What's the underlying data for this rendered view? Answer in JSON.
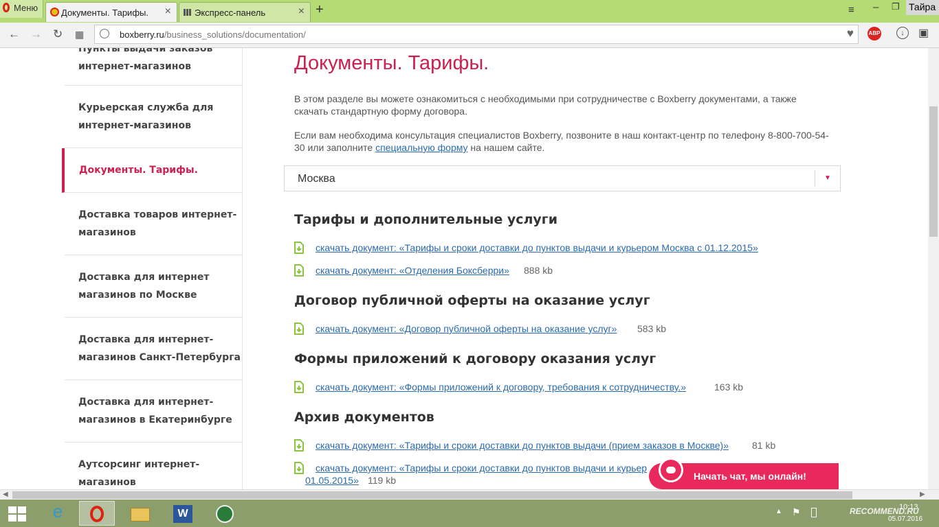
{
  "browser": {
    "menu_label": "Меню",
    "tabs": [
      {
        "title": "Документы. Тарифы.",
        "active": true
      },
      {
        "title": "Экспресс-панель",
        "active": false
      }
    ],
    "user_label": "Тайра",
    "url_domain": "boxberry.ru",
    "url_path": "/business_solutions/documentation/",
    "adblock_label": "ABP"
  },
  "sidebar": {
    "items": [
      {
        "line1": "Пункты выдачи заказов",
        "line2": "интернет-магазинов",
        "active": false
      },
      {
        "line1": "Курьерская служба для",
        "line2": "интернет-магазинов",
        "active": false
      },
      {
        "line1": "Документы. Тарифы.",
        "line2": "",
        "active": true
      },
      {
        "line1": "Доставка товаров интернет-",
        "line2": "магазинов",
        "active": false
      },
      {
        "line1": "Доставка для интернет",
        "line2": "магазинов по Москве",
        "active": false
      },
      {
        "line1": "Доставка для интернет-",
        "line2": "магазинов Санкт-Петербурга",
        "active": false
      },
      {
        "line1": "Доставка для интернет-",
        "line2": "магазинов в Екатеринбурге",
        "active": false
      },
      {
        "line1": "Аутсорсинг интернет-",
        "line2": "магазинов",
        "active": false
      }
    ]
  },
  "main": {
    "title": "Документы. Тарифы.",
    "intro1": "В этом разделе вы можете ознакомиться с необходимыми при сотрудничестве с Boxberry документами, а также скачать стандартную форму договора.",
    "intro2_before": "Если вам необходима консультация специалистов Boxberry, позвоните в наш контакт-центр по телефону 8-800-700-54-30 или заполните ",
    "intro2_link": "специальную форму",
    "intro2_after": " на нашем сайте.",
    "city_value": "Москва",
    "sections": [
      {
        "heading": "Тарифы и дополнительные услуги",
        "docs": [
          {
            "link": "скачать документ: «Тарифы и сроки доставки до пунктов выдачи и курьером Москва с 01.12.2015»",
            "size": ""
          },
          {
            "link": "скачать документ: «Отделения Боксберри»",
            "size": "888 kb"
          }
        ]
      },
      {
        "heading": "Договор публичной оферты на оказание услуг",
        "docs": [
          {
            "link": "скачать документ: «Договор публичной оферты на оказание услуг»",
            "size": "583 kb"
          }
        ]
      },
      {
        "heading": "Формы приложений к договору оказания услуг",
        "docs": [
          {
            "link": "скачать документ: «Формы приложений к договору, требования к сотрудничеству.»",
            "size": "163 kb"
          }
        ]
      },
      {
        "heading": "Архив документов",
        "docs": [
          {
            "link": "скачать документ: «Тарифы и сроки доставки до пунктов выдачи (прием заказов в Москве)»",
            "size": "81 kb"
          },
          {
            "link": "скачать документ: «Тарифы и сроки доставки до пунктов выдачи и курьер",
            "link_cont": "01.05.2015»",
            "size": "119 kb"
          }
        ]
      }
    ]
  },
  "chat": {
    "label": "Начать чат, мы онлайн!"
  },
  "taskbar": {
    "time": "10:13",
    "date": "05.07.2016",
    "watermark": "RECOMMEND.RU"
  },
  "colors": {
    "accent": "#cc1f52",
    "link": "#2a6bb0",
    "chrome_green": "#b5dc74",
    "doc_icon": "#8cc63f"
  }
}
